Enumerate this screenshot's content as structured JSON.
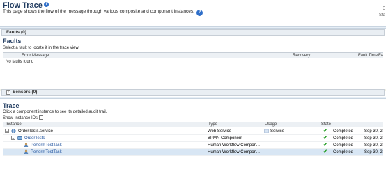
{
  "header": {
    "title": "Flow Trace",
    "subtitle": "This page shows the flow of the message through various composite and component instances.",
    "right_top": "E",
    "right_bottom": "Sta"
  },
  "faults_section": {
    "bar_label": "Faults (0)",
    "title": "Faults",
    "hint": "Select a fault to locate it in the trace view.",
    "columns": [
      "Error Message",
      "Recovery",
      "Fault Time",
      "Fa"
    ],
    "empty": "No faults found"
  },
  "sensors_section": {
    "bar_label": "Sensors (0)"
  },
  "trace_section": {
    "title": "Trace",
    "hint": "Click a component instance to see its detailed audit trail.",
    "show_ids": "Show Instance IDs",
    "columns": [
      "Instance",
      "Type",
      "Usage",
      "State"
    ],
    "rows": [
      {
        "instance": "OrderTests.service",
        "type": "Web Service",
        "usage": "Service",
        "state": "Completed",
        "date": "Sep 30, 2"
      },
      {
        "instance": "OrderTests",
        "type": "BPMN Component",
        "usage": "",
        "state": "Completed",
        "date": "Sep 30, 2"
      },
      {
        "instance": "PerformTestTask",
        "type": "Human Workflow Compon...",
        "usage": "",
        "state": "Completed",
        "date": "Sep 30, 2"
      },
      {
        "instance": "PerformTestTask",
        "type": "Human Workflow Compon...",
        "usage": "",
        "state": "Completed",
        "date": "Sep 30, 2"
      }
    ]
  },
  "icons": {
    "title_info": "info-icon",
    "help": "help-icon",
    "check": "check-icon",
    "colors": {
      "title": "#1f3a5f",
      "link": "#1b4f9c",
      "check": "#1d9a1d",
      "selected_row": "#d8e6f4"
    }
  }
}
